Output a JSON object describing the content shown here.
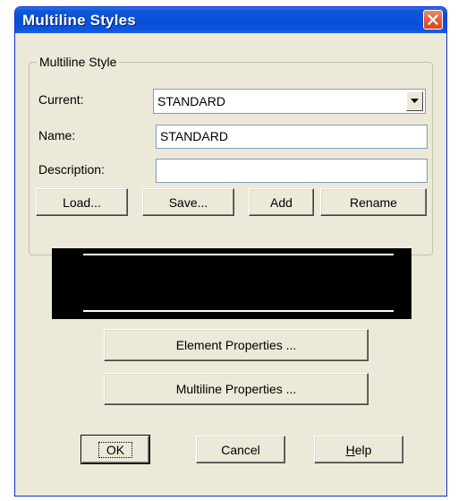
{
  "window": {
    "title": "Multiline Styles"
  },
  "group": {
    "legend": "Multiline Style"
  },
  "fields": {
    "current_label": "Current:",
    "current_value": "STANDARD",
    "name_label": "Name:",
    "name_value": "STANDARD",
    "description_label": "Description:",
    "description_value": ""
  },
  "buttons": {
    "load": "Load...",
    "save": "Save...",
    "add": "Add",
    "rename": "Rename",
    "element_properties": "Element Properties ...",
    "multiline_properties": "Multiline Properties ...",
    "ok": "OK",
    "cancel": "Cancel",
    "help_h": "H",
    "help_rest": "elp"
  },
  "colors": {
    "titlebar": "#0a4ed6",
    "close": "#e2572f",
    "dialog_bg": "#ece9d8",
    "preview_bg": "#000000",
    "preview_line": "#ffffff"
  },
  "icons": {
    "close": "close-icon",
    "dropdown": "chevron-down-icon"
  }
}
